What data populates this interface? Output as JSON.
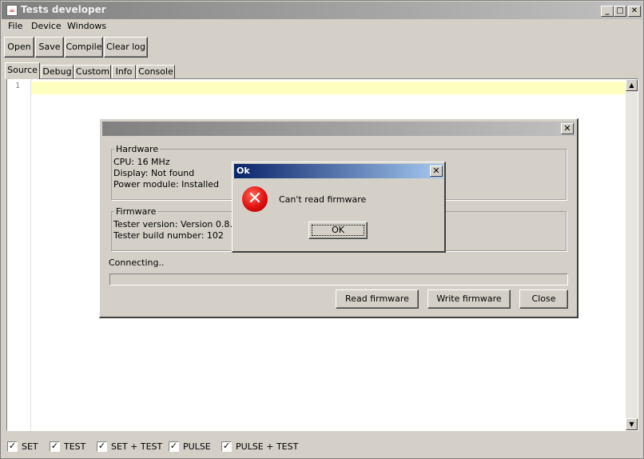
{
  "window": {
    "title": "Tests developer",
    "icon": "java-cup-icon"
  },
  "caption_buttons": {
    "minimize": "_",
    "maximize": "□",
    "close": "✕"
  },
  "menu": [
    "File",
    "Device",
    "Windows"
  ],
  "toolbar": [
    "Open",
    "Save",
    "Compile",
    "Clear log"
  ],
  "tabs": [
    "Source",
    "Debug",
    "Custom",
    "Info",
    "Console"
  ],
  "editor": {
    "line_number": "1"
  },
  "checkboxes": [
    {
      "label": "SET",
      "checked": true
    },
    {
      "label": "TEST",
      "checked": true
    },
    {
      "label": "SET + TEST",
      "checked": true
    },
    {
      "label": "PULSE",
      "checked": true
    },
    {
      "label": "PULSE + TEST",
      "checked": true
    }
  ],
  "firmware_dialog": {
    "hardware": {
      "title": "Hardware",
      "cpu": "CPU: 16 MHz",
      "display": "Display: Not found",
      "power": "Power module: Installed"
    },
    "firmware": {
      "title": "Firmware",
      "version": "Tester version: Version 0.8.12",
      "build": "Tester build number: 102"
    },
    "status": "Connecting..",
    "progress": 0,
    "buttons": {
      "read": "Read firmware",
      "write": "Write firmware",
      "close": "Close"
    }
  },
  "message_dialog": {
    "title": "Ok",
    "message": "Can't read firmware",
    "ok_label": "OK",
    "icon": "error-icon"
  }
}
